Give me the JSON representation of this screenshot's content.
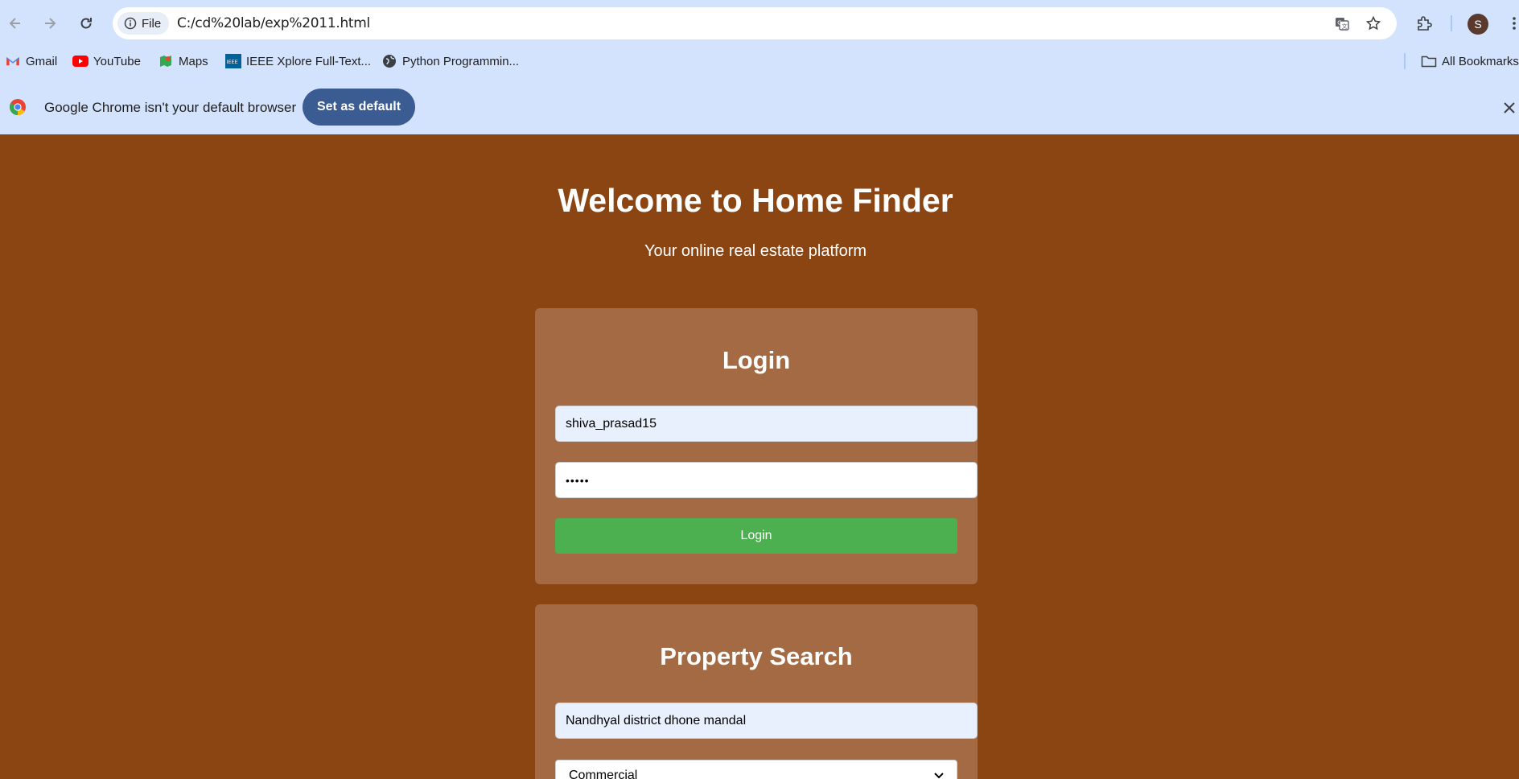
{
  "browser": {
    "url": "C:/cd%20lab/exp%2011.html",
    "site_chip": "File",
    "avatar_letter": "S",
    "bookmarks": [
      {
        "label": "Gmail",
        "icon": "gmail-icon"
      },
      {
        "label": "YouTube",
        "icon": "youtube-icon"
      },
      {
        "label": "Maps",
        "icon": "maps-icon"
      },
      {
        "label": "IEEE Xplore Full-Text...",
        "icon": "ieee-icon"
      },
      {
        "label": "Python Programmin...",
        "icon": "globe-icon"
      }
    ],
    "all_bookmarks": "All Bookmarks",
    "infobar": {
      "message": "Google Chrome isn't your default browser",
      "button": "Set as default"
    }
  },
  "page": {
    "title": "Welcome to Home Finder",
    "subtitle": "Your online real estate platform",
    "login": {
      "heading": "Login",
      "username_value": "shiva_prasad15",
      "password_value": "•••••",
      "button": "Login"
    },
    "search": {
      "heading": "Property Search",
      "location_value": "Nandhyal district dhone mandal",
      "type_selected": "Commercial"
    }
  },
  "colors": {
    "page_bg": "#8b4513",
    "card_bg": "#a36a43",
    "login_button": "#4caf50",
    "chrome_bg": "#d3e3fd",
    "set_default_bg": "#3b5b93"
  }
}
